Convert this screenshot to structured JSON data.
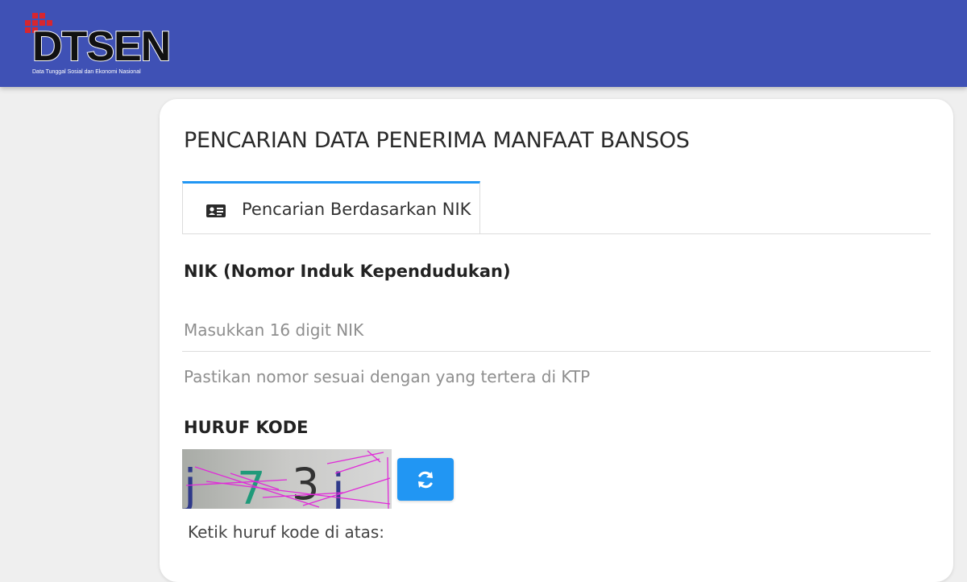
{
  "colors": {
    "header": "#3f51b5",
    "accent": "#2196f3",
    "logo_squares": "#d7262f"
  },
  "header": {
    "logo_text": "DTSEN",
    "logo_subtitle": "Data Tunggal Sosial dan Ekonomi Nasional"
  },
  "main": {
    "title": "PENCARIAN DATA PENERIMA MANFAAT BANSOS",
    "tabs": [
      {
        "label": "Pencarian Berdasarkan NIK",
        "icon": "id-card-icon",
        "active": true
      }
    ],
    "nik": {
      "label": "NIK (Nomor Induk Kependudukan)",
      "placeholder": "Masukkan 16 digit NIK",
      "value": "",
      "help": "Pastikan nomor sesuai dengan yang tertera di KTP"
    },
    "kode": {
      "label": "HURUF KODE",
      "captcha_chars": [
        "j",
        "7",
        "3",
        "j"
      ],
      "refresh_icon": "refresh-icon",
      "help": "Ketik huruf kode di atas:"
    }
  }
}
